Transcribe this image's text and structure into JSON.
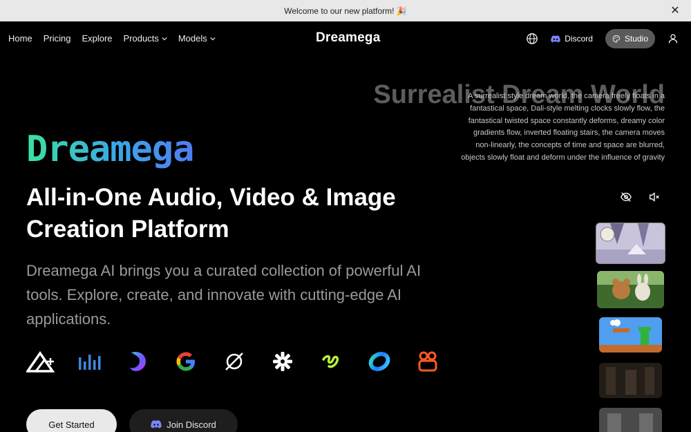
{
  "announcement": {
    "text": "Welcome to our new platform! 🎉"
  },
  "nav": {
    "items": [
      {
        "label": "Home"
      },
      {
        "label": "Pricing"
      },
      {
        "label": "Explore"
      },
      {
        "label": "Products"
      },
      {
        "label": "Models"
      }
    ],
    "logo": "Dreamega",
    "discord_label": "Discord",
    "studio_label": "Studio"
  },
  "hero": {
    "brand": "Dreamega",
    "headline": "All-in-One Audio, Video & Image Creation Platform",
    "subtext": "Dreamega AI brings you a curated collection of powerful AI tools. Explore, create, and innovate with cutting-edge AI applications.",
    "cta_primary": "Get Started",
    "cta_secondary": "Join Discord",
    "partner_logos": [
      "triangle-logo",
      "bars-logo",
      "gradient-swoosh-logo",
      "google-g-logo",
      "slashed-circle-logo",
      "starburst-logo",
      "green-squiggle-logo",
      "ring-logo",
      "camera-logo"
    ]
  },
  "showcase": {
    "title": "Surrealist Dream World",
    "description": "A surrealist style dream world, the camera freely floats in a fantastical space, Dali-style melting clocks slowly flow, the fantastical twisted space constantly deforms, dreamy color gradients flow, inverted floating stairs, the camera moves non-linearly, the concepts of time and space are blurred, objects slowly float and deform under the influence of gravity"
  },
  "colors": {
    "accent_green": "#3ee0a0",
    "accent_blue": "#4f7cf0",
    "discord": "#5865f2"
  }
}
